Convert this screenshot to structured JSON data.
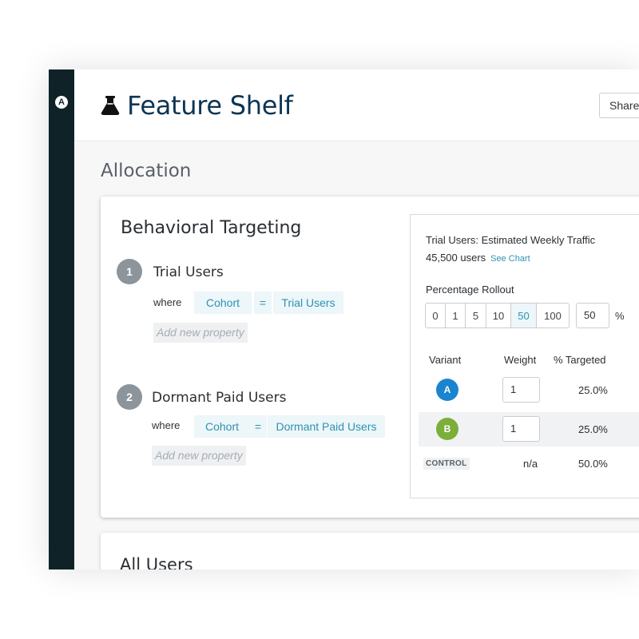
{
  "header": {
    "title": "Feature Shelf",
    "share_label": "Share"
  },
  "allocation": {
    "title": "Allocation"
  },
  "behavioral": {
    "title": "Behavioral Targeting",
    "segments": [
      {
        "number": "1",
        "name": "Trial Users",
        "where_label": "where",
        "property": "Cohort",
        "operator": "=",
        "value": "Trial Users",
        "add_placeholder": "Add new property"
      },
      {
        "number": "2",
        "name": "Dormant Paid Users",
        "where_label": "where",
        "property": "Cohort",
        "operator": "=",
        "value": "Dormant Paid Users",
        "add_placeholder": "Add new property"
      }
    ]
  },
  "panel": {
    "traffic_title": "Trial Users: Estimated Weekly Traffic",
    "users_count": "45,500 users",
    "see_chart": "See Chart",
    "rollout_label": "Percentage Rollout",
    "rollout_options": [
      "0",
      "1",
      "5",
      "10",
      "50",
      "100"
    ],
    "rollout_selected": "50",
    "rollout_value": "50",
    "rollout_suffix": "%",
    "headers": {
      "variant": "Variant",
      "weight": "Weight",
      "targeted": "% Targeted"
    },
    "variants": [
      {
        "label": "A",
        "weight": "1",
        "targeted": "25.0%",
        "color": "#1a84cf"
      },
      {
        "label": "B",
        "weight": "1",
        "targeted": "25.0%",
        "color": "#7cae3a"
      }
    ],
    "control": {
      "label": "CONTROL",
      "weight": "n/a",
      "targeted": "50.0%"
    }
  },
  "all_users": {
    "title": "All Users"
  },
  "colors": {
    "sidebar": "#0f2228",
    "title": "#0d3553",
    "accent": "#2f92b3"
  },
  "icons": {
    "logo": "amplitude-logo-icon",
    "title": "flask-icon"
  }
}
